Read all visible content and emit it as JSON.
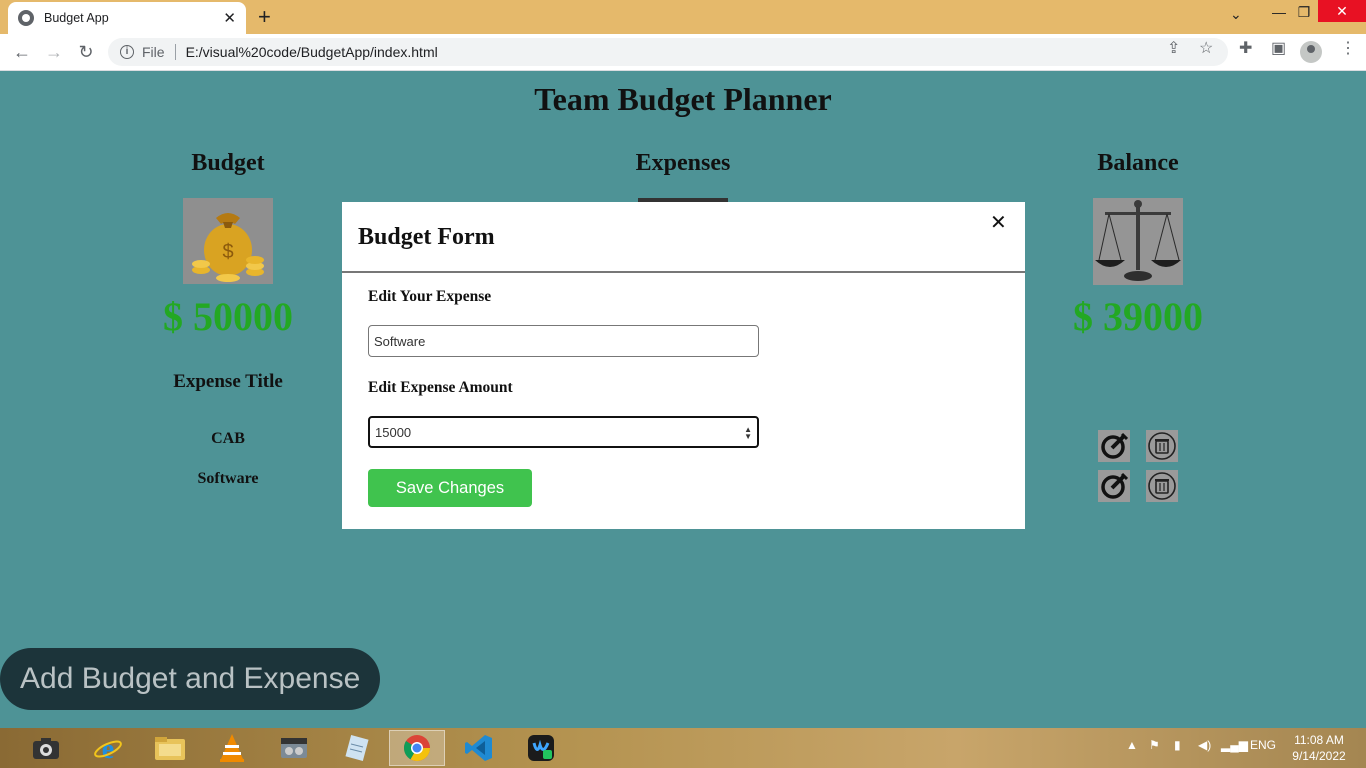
{
  "browser": {
    "tab_title": "Budget App",
    "new_tab": "+",
    "tab_close": "✕",
    "address_scheme": "File",
    "address_url": "E:/visual%20code/BudgetApp/index.html"
  },
  "page": {
    "title": "Team Budget Planner",
    "budget": {
      "heading": "Budget",
      "amount": "$ 50000"
    },
    "expenses": {
      "heading": "Expenses"
    },
    "balance": {
      "heading": "Balance",
      "amount": "$ 39000"
    },
    "expense_list": {
      "heading": "Expense Title",
      "items": [
        {
          "title": "CAB"
        },
        {
          "title": "Software"
        }
      ]
    },
    "add_button": "Add Budget and Expense"
  },
  "modal": {
    "title": "Budget Form",
    "close": "✕",
    "expense_label": "Edit Your Expense",
    "expense_value": "Software",
    "amount_label": "Edit Expense Amount",
    "amount_value": "15000",
    "save_button": "Save Changes"
  },
  "taskbar": {
    "language": "ENG",
    "time": "11:08 AM",
    "date": "9/14/2022"
  },
  "colors": {
    "page_background": "#4e9396",
    "amount_green": "#23a823",
    "save_green": "#40c34e",
    "add_button_bg": "#1c343a"
  }
}
